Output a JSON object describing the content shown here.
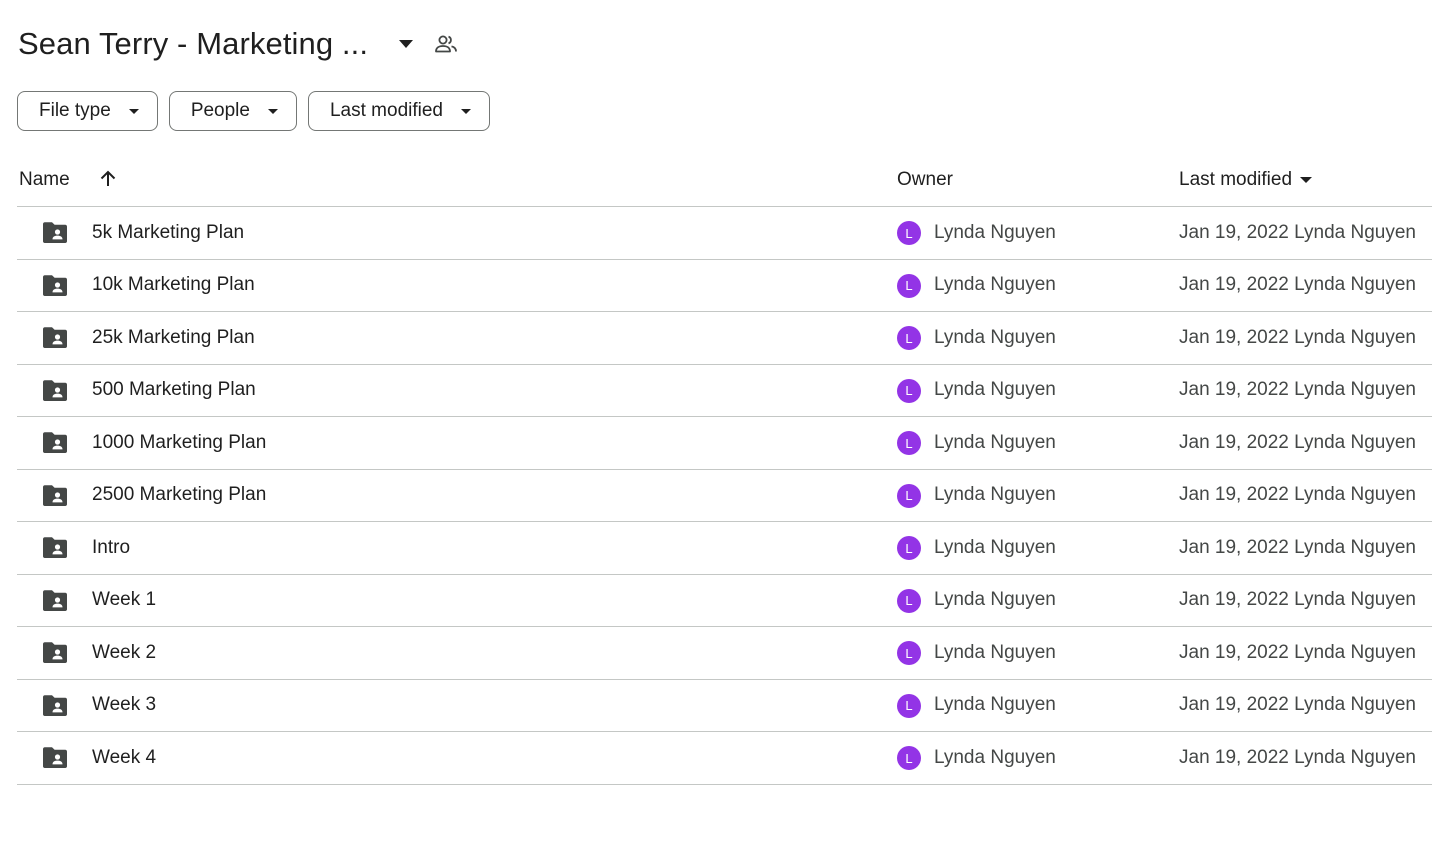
{
  "header": {
    "title": "Sean Terry - Marketing ...",
    "title_menu_icon": "arrow-drop-down-icon",
    "shared_icon": "people-outline-icon"
  },
  "filters": [
    {
      "label": "File type"
    },
    {
      "label": "People"
    },
    {
      "label": "Last modified"
    }
  ],
  "columns": {
    "name": "Name",
    "owner": "Owner",
    "last_modified": "Last modified",
    "sort_icon": "arrow-upward-icon"
  },
  "colors": {
    "avatar": "#9334e6",
    "folder": "#444746",
    "divider": "#c4c7c5"
  },
  "files": [
    {
      "name": "5k Marketing Plan",
      "owner_initial": "L",
      "owner": "Lynda Nguyen",
      "modified": "Jan 19, 2022 Lynda Nguyen"
    },
    {
      "name": "10k Marketing Plan",
      "owner_initial": "L",
      "owner": "Lynda Nguyen",
      "modified": "Jan 19, 2022 Lynda Nguyen"
    },
    {
      "name": "25k Marketing Plan",
      "owner_initial": "L",
      "owner": "Lynda Nguyen",
      "modified": "Jan 19, 2022 Lynda Nguyen"
    },
    {
      "name": "500 Marketing Plan",
      "owner_initial": "L",
      "owner": "Lynda Nguyen",
      "modified": "Jan 19, 2022 Lynda Nguyen"
    },
    {
      "name": "1000 Marketing Plan",
      "owner_initial": "L",
      "owner": "Lynda Nguyen",
      "modified": "Jan 19, 2022 Lynda Nguyen"
    },
    {
      "name": "2500 Marketing Plan",
      "owner_initial": "L",
      "owner": "Lynda Nguyen",
      "modified": "Jan 19, 2022 Lynda Nguyen"
    },
    {
      "name": "Intro",
      "owner_initial": "L",
      "owner": "Lynda Nguyen",
      "modified": "Jan 19, 2022 Lynda Nguyen"
    },
    {
      "name": "Week 1",
      "owner_initial": "L",
      "owner": "Lynda Nguyen",
      "modified": "Jan 19, 2022 Lynda Nguyen"
    },
    {
      "name": "Week 2",
      "owner_initial": "L",
      "owner": "Lynda Nguyen",
      "modified": "Jan 19, 2022 Lynda Nguyen"
    },
    {
      "name": "Week 3",
      "owner_initial": "L",
      "owner": "Lynda Nguyen",
      "modified": "Jan 19, 2022 Lynda Nguyen"
    },
    {
      "name": "Week 4",
      "owner_initial": "L",
      "owner": "Lynda Nguyen",
      "modified": "Jan 19, 2022 Lynda Nguyen"
    }
  ]
}
